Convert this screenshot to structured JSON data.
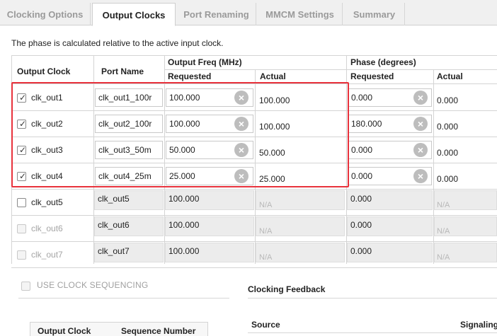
{
  "tabs": [
    {
      "label": "Clocking Options",
      "active": false
    },
    {
      "label": "Output Clocks",
      "active": true
    },
    {
      "label": "Port Renaming",
      "active": false
    },
    {
      "label": "MMCM Settings",
      "active": false
    },
    {
      "label": "Summary",
      "active": false
    }
  ],
  "info_text": "The phase is calculated relative to the active input clock.",
  "table": {
    "headers": {
      "output_clock": "Output Clock",
      "port_name": "Port Name",
      "output_freq": "Output Freq (MHz)",
      "phase": "Phase (degrees)",
      "requested": "Requested",
      "actual": "Actual"
    },
    "rows": [
      {
        "checked": true,
        "enabled": true,
        "clock": "clk_out1",
        "port": "clk_out1_100r",
        "freq_req": "100.000",
        "freq_act": "100.000",
        "phase_req": "0.000",
        "phase_act": "0.000"
      },
      {
        "checked": true,
        "enabled": true,
        "clock": "clk_out2",
        "port": "clk_out2_100r",
        "freq_req": "100.000",
        "freq_act": "100.000",
        "phase_req": "180.000",
        "phase_act": "0.000"
      },
      {
        "checked": true,
        "enabled": true,
        "clock": "clk_out3",
        "port": "clk_out3_50m",
        "freq_req": "50.000",
        "freq_act": "50.000",
        "phase_req": "0.000",
        "phase_act": "0.000"
      },
      {
        "checked": true,
        "enabled": true,
        "clock": "clk_out4",
        "port": "clk_out4_25m",
        "freq_req": "25.000",
        "freq_act": "25.000",
        "phase_req": "0.000",
        "phase_act": "0.000"
      },
      {
        "checked": false,
        "enabled": true,
        "clock": "clk_out5",
        "port": "clk_out5",
        "freq_req": "100.000",
        "freq_act": "N/A",
        "phase_req": "0.000",
        "phase_act": "N/A"
      },
      {
        "checked": false,
        "enabled": false,
        "clock": "clk_out6",
        "port": "clk_out6",
        "freq_req": "100.000",
        "freq_act": "N/A",
        "phase_req": "0.000",
        "phase_act": "N/A"
      },
      {
        "checked": false,
        "enabled": false,
        "clock": "clk_out7",
        "port": "clk_out7",
        "freq_req": "100.000",
        "freq_act": "N/A",
        "phase_req": "0.000",
        "phase_act": "N/A"
      }
    ]
  },
  "sequencing": {
    "label": "USE CLOCK SEQUENCING",
    "checked": false
  },
  "seq_table": {
    "col1": "Output Clock",
    "col2": "Sequence Number"
  },
  "feedback": {
    "title": "Clocking Feedback",
    "source": "Source",
    "signaling": "Signaling"
  },
  "colors": {
    "highlight": "#e8323c",
    "clear_button": "#bdbdbd"
  }
}
